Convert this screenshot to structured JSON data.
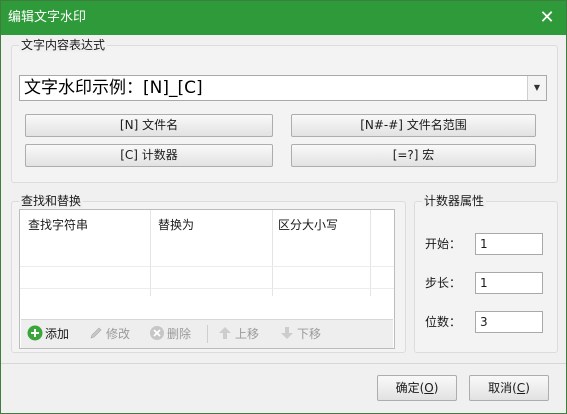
{
  "window": {
    "title": "编辑文字水印",
    "close_glyph": "✕"
  },
  "expression_group": {
    "label": "文字内容表达式",
    "combo_value": "文字水印示例：[N]_[C]",
    "buttons": {
      "filename": "[N] 文件名",
      "filename_range": "[N#-#] 文件名范围",
      "counter": "[C] 计数器",
      "macro": "[=?] 宏"
    }
  },
  "replace_group": {
    "label": "查找和替换",
    "columns": [
      "查找字符串",
      "替换为",
      "区分大小写"
    ],
    "toolbar": {
      "add": "添加",
      "edit": "修改",
      "delete": "删除",
      "move_up": "上移",
      "move_down": "下移"
    }
  },
  "counter_group": {
    "label": "计数器属性",
    "start_label": "开始：",
    "start_value": "1",
    "step_label": "步长：",
    "step_value": "1",
    "digits_label": "位数：",
    "digits_value": "3"
  },
  "footer": {
    "ok_label": "确定(",
    "ok_key": "O",
    "ok_end": ")",
    "cancel_label": "取消(",
    "cancel_key": "C",
    "cancel_end": ")"
  },
  "colors": {
    "titlebar": "#2f9a3a",
    "add_icon": "#3aa63a"
  }
}
